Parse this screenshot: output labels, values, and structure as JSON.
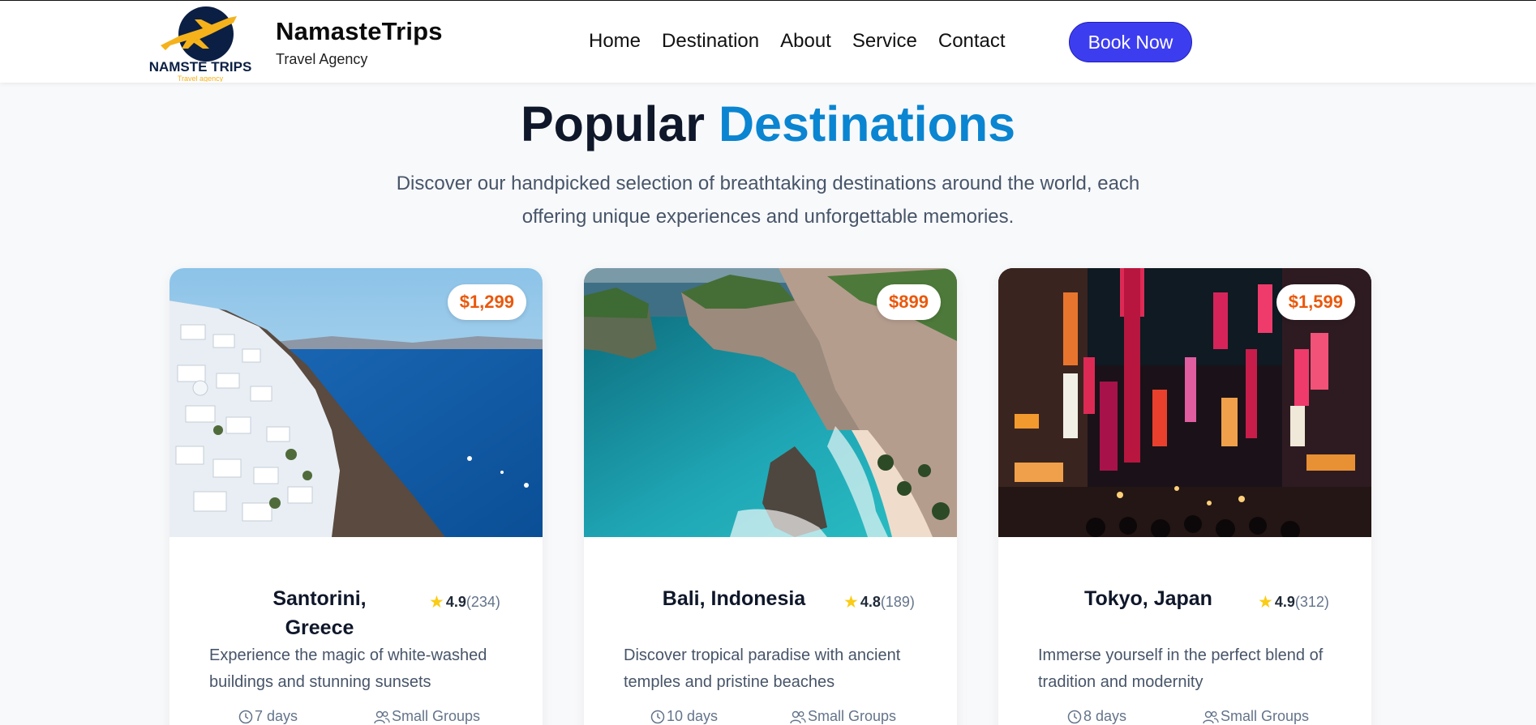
{
  "brand": {
    "name": "NamasteTrips",
    "tagline": "Travel Agency",
    "logo_text": "NAMSTE TRIPS",
    "logo_sub": "Travel agency"
  },
  "nav": {
    "items": [
      "Home",
      "Destination",
      "About",
      "Service",
      "Contact"
    ],
    "cta": "Book Now"
  },
  "section": {
    "title_main": "Popular",
    "title_accent": "Destinations",
    "subtitle_line1": "Discover our handpicked selection of breathtaking destinations around the world, each",
    "subtitle_line2": "offering unique experiences and unforgettable memories."
  },
  "cards": [
    {
      "name_line1": "Santorini,",
      "name_line2": "Greece",
      "price": "$1,299",
      "rating": "4.9",
      "reviews": "(234)",
      "desc_line1": "Experience the magic of white-washed",
      "desc_line2": "buildings and stunning sunsets",
      "duration": "7 days",
      "group": "Small Groups",
      "image": "santorini-photo"
    },
    {
      "name_line1": "Bali, Indonesia",
      "name_line2": "",
      "price": "$899",
      "rating": "4.8",
      "reviews": "(189)",
      "desc_line1": "Discover tropical paradise with ancient",
      "desc_line2": "temples and pristine beaches",
      "duration": "10 days",
      "group": "Small Groups",
      "image": "bali-photo"
    },
    {
      "name_line1": "Tokyo, Japan",
      "name_line2": "",
      "price": "$1,599",
      "rating": "4.9",
      "reviews": "(312)",
      "desc_line1": "Immerse yourself in the perfect blend of",
      "desc_line2": "tradition and modernity",
      "duration": "8 days",
      "group": "Small Groups",
      "image": "tokyo-photo"
    }
  ],
  "colors": {
    "accent": "#0a85d1",
    "cta": "#3d3df0",
    "price": "#ea580c",
    "star": "#facc15",
    "logo_navy": "#0b1f44",
    "logo_gold": "#f5b21b"
  }
}
